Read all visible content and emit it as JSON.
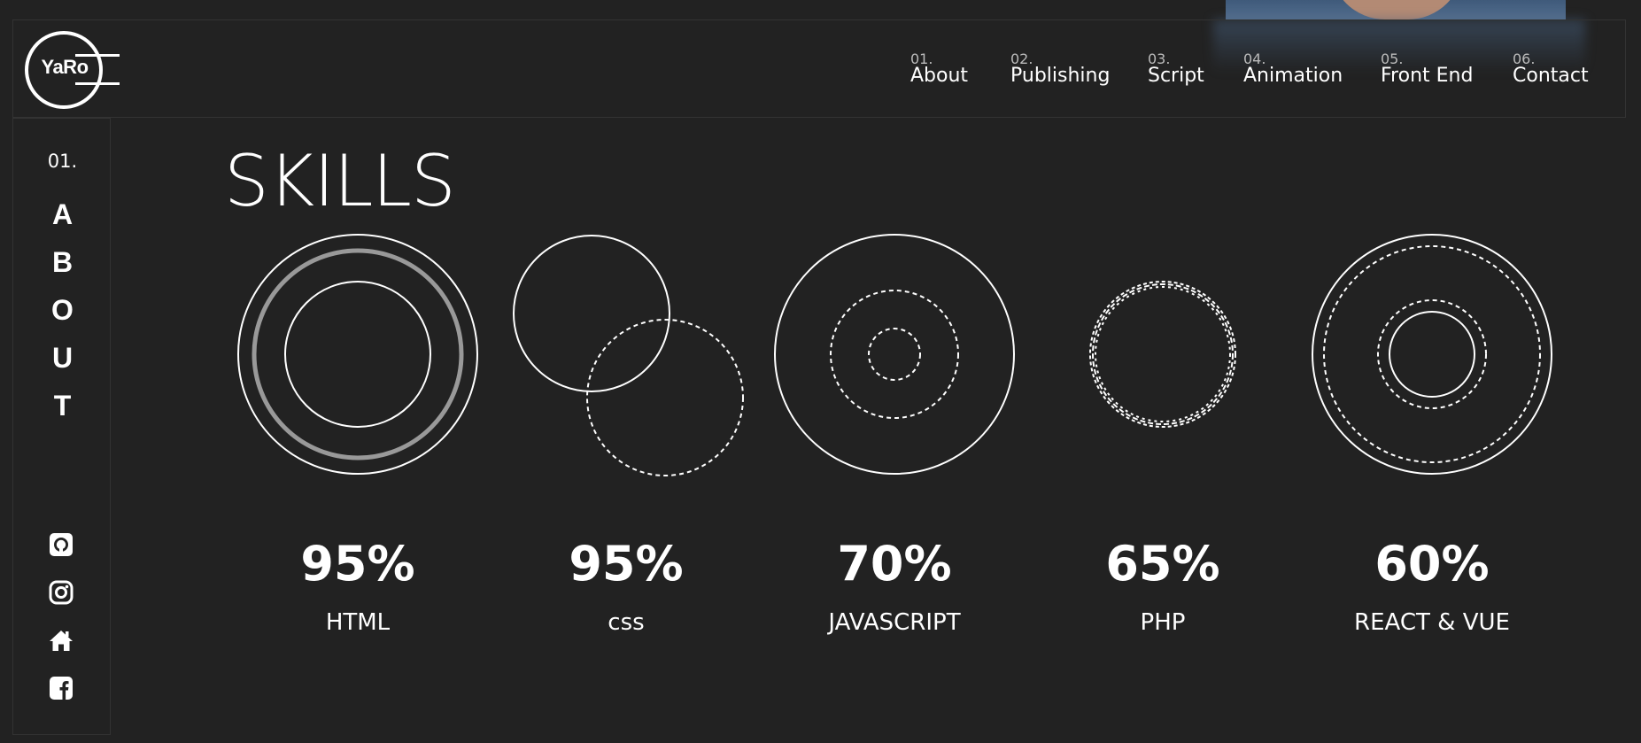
{
  "logo": {
    "text": "YaRo"
  },
  "nav": [
    {
      "num": "01.",
      "label": "About"
    },
    {
      "num": "02.",
      "label": "Publishing"
    },
    {
      "num": "03.",
      "label": "Script"
    },
    {
      "num": "04.",
      "label": "Animation"
    },
    {
      "num": "05.",
      "label": "Front End"
    },
    {
      "num": "06.",
      "label": "Contact"
    }
  ],
  "sidebar": {
    "num": "01.",
    "letters": [
      "A",
      "B",
      "O",
      "U",
      "T"
    ],
    "social_icons": [
      "github-icon",
      "instagram-icon",
      "home-icon",
      "facebook-icon"
    ]
  },
  "section": {
    "title": "SKILLS"
  },
  "skills": [
    {
      "percent": "95%",
      "name": "HTML"
    },
    {
      "percent": "95%",
      "name": "css"
    },
    {
      "percent": "70%",
      "name": "JAVASCRIPT"
    },
    {
      "percent": "65%",
      "name": "PHP"
    },
    {
      "percent": "60%",
      "name": "REACT & VUE"
    }
  ],
  "colors": {
    "background": "#222222",
    "foreground": "#ffffff",
    "ring_accent": "#999999",
    "border": "#333333"
  }
}
